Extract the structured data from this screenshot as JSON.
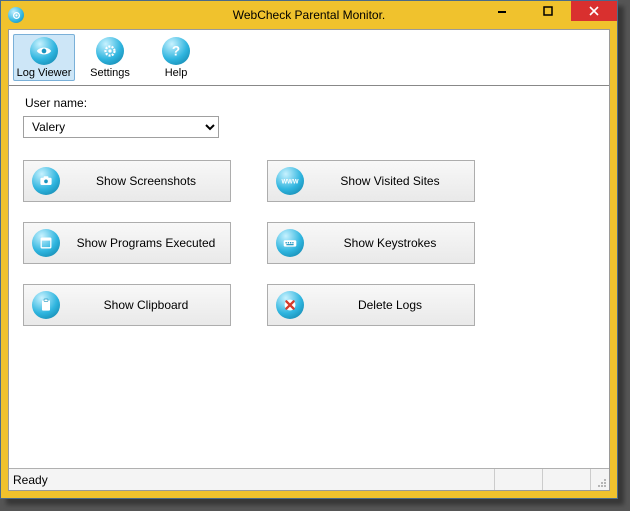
{
  "window": {
    "title": "WebCheck Parental Monitor."
  },
  "toolbar": {
    "log_viewer": "Log Viewer",
    "settings": "Settings",
    "help": "Help"
  },
  "user": {
    "label": "User name:",
    "selected": "Valery",
    "options": [
      "Valery"
    ]
  },
  "actions": {
    "screenshots": "Show Screenshots",
    "visited": "Show Visited Sites",
    "programs": "Show Programs Executed",
    "keystrokes": "Show Keystrokes",
    "clipboard": "Show Clipboard",
    "delete": "Delete Logs"
  },
  "status": {
    "text": "Ready"
  }
}
